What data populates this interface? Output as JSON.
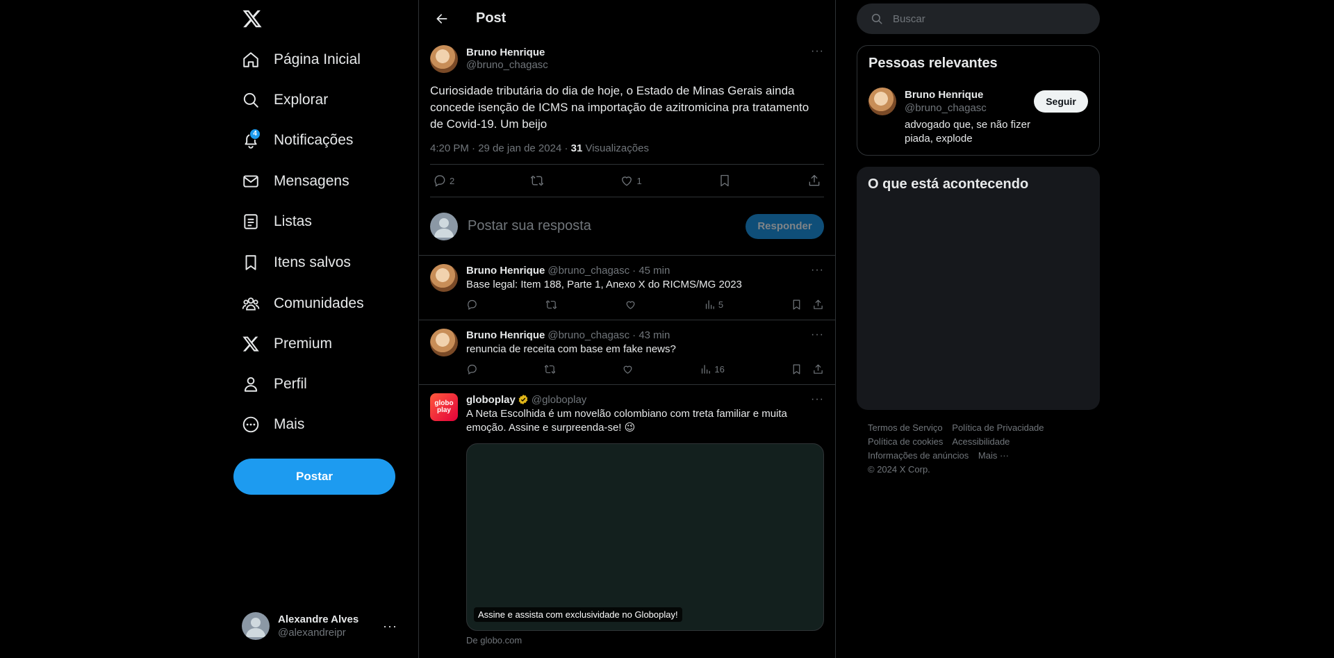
{
  "nav": {
    "items": [
      {
        "label": "Página Inicial",
        "icon": "home-icon"
      },
      {
        "label": "Explorar",
        "icon": "search-icon"
      },
      {
        "label": "Notificações",
        "icon": "bell-icon",
        "badge": "4"
      },
      {
        "label": "Mensagens",
        "icon": "mail-icon"
      },
      {
        "label": "Listas",
        "icon": "list-icon"
      },
      {
        "label": "Itens salvos",
        "icon": "bookmark-icon"
      },
      {
        "label": "Comunidades",
        "icon": "communities-icon"
      },
      {
        "label": "Premium",
        "icon": "x-logo-icon"
      },
      {
        "label": "Perfil",
        "icon": "person-icon"
      },
      {
        "label": "Mais",
        "icon": "more-circle-icon"
      }
    ],
    "post_button": "Postar",
    "account": {
      "name": "Alexandre Alves",
      "handle": "@alexandreipr"
    }
  },
  "main": {
    "title": "Post",
    "focal": {
      "name": "Bruno Henrique",
      "handle": "@bruno_chagasc",
      "text": "Curiosidade tributária do dia de hoje, o Estado de Minas Gerais ainda concede isenção de ICMS na importação de azitromicina pra tratamento de Covid-19. Um beijo",
      "meta_time": "4:20 PM · 29 de jan de 2024 · ",
      "views_count": "31",
      "views_label": " Visualizações",
      "replies": "2",
      "likes": "1"
    },
    "reply_box": {
      "placeholder": "Postar sua resposta",
      "button": "Responder"
    },
    "replies": [
      {
        "name": "Bruno Henrique",
        "handle": "@bruno_chagasc",
        "time": "· 45 min",
        "text": "Base legal: Item 188, Parte 1, Anexo X do RICMS/MG 2023",
        "views": "5"
      },
      {
        "name": "Bruno Henrique",
        "handle": "@bruno_chagasc",
        "time": "· 43 min",
        "text": "renuncia de receita com base em fake news?",
        "views": "16"
      }
    ],
    "ad": {
      "name": "globoplay",
      "handle": "@globoplay",
      "avatar_text": "globo play",
      "text": "A Neta Escolhida é um novelão colombiano com treta familiar e muita emoção. Assine e surpreenda-se! 😉",
      "cta": "Assine e assista com exclusividade no Globoplay!",
      "source": "De globo.com"
    }
  },
  "right": {
    "search_placeholder": "Buscar",
    "relevant": {
      "title": "Pessoas relevantes",
      "name": "Bruno Henrique",
      "handle": "@bruno_chagasc",
      "bio": "advogado que, se não fizer piada, explode",
      "follow": "Seguir"
    },
    "trending_title": "O que está acontecendo",
    "footer": {
      "links": [
        "Termos de Serviço",
        "Política de Privacidade",
        "Política de cookies",
        "Acessibilidade",
        "Informações de anúncios",
        "Mais ···"
      ],
      "copyright": "© 2024 X Corp."
    }
  },
  "colors": {
    "accent": "#1d9bf0",
    "background": "#000000",
    "text": "#e7e9ea",
    "muted": "#71767b",
    "border": "#2f3336"
  }
}
